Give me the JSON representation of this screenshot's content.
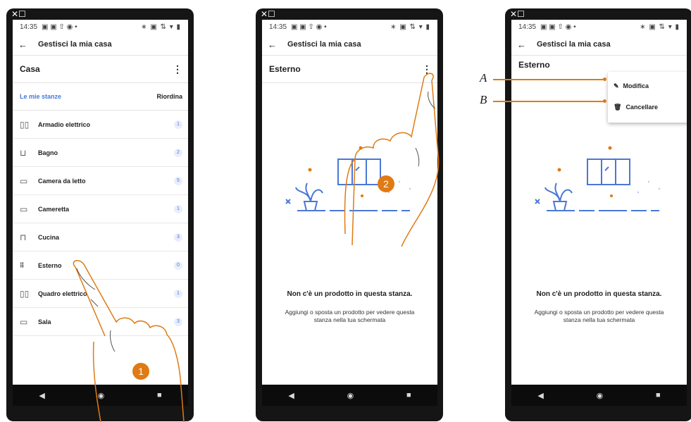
{
  "status": {
    "time": "14:35",
    "left_icons": "▣ ▣ ⇧ ◉ •",
    "right_icons": "∗ ▣ ⇅ ▾ ▮"
  },
  "window_icons": "✕☐",
  "appbar": {
    "back_icon": "←",
    "title": "Gestisci la mia casa"
  },
  "screen1": {
    "header": "Casa",
    "section_title": "Le mie stanze",
    "reorder": "Riordina",
    "rooms": [
      {
        "label": "Armadio elettrico",
        "count": "1",
        "icon": "▯▯"
      },
      {
        "label": "Bagno",
        "count": "2",
        "icon": "⊔"
      },
      {
        "label": "Camera da letto",
        "count": "5",
        "icon": "▭"
      },
      {
        "label": "Cameretta",
        "count": "1",
        "icon": "▭"
      },
      {
        "label": "Cucina",
        "count": "3",
        "icon": "⊓"
      },
      {
        "label": "Esterno",
        "count": "0",
        "icon": "⩩"
      },
      {
        "label": "Quadro elettrico",
        "count": "1",
        "icon": "▯▯"
      },
      {
        "label": "Sala",
        "count": "3",
        "icon": "▭"
      }
    ],
    "step": "1"
  },
  "screen2": {
    "header": "Esterno",
    "empty_title": "Non c'è un prodotto in questa stanza.",
    "empty_desc": "Aggiungi o sposta un prodotto per vedere questa stanza nella tua schermata",
    "step": "2"
  },
  "screen3": {
    "header": "Esterno",
    "menu": {
      "edit": "Modifica",
      "delete": "Cancellare"
    },
    "empty_title": "Non c'è un prodotto in questa stanza.",
    "empty_desc": "Aggiungi o sposta un prodotto per vedere questa stanza nella tua schermata"
  },
  "callouts": {
    "a": "A",
    "b": "B"
  },
  "navbar": {
    "back": "◀",
    "home": "◉",
    "recents": "■"
  },
  "colors": {
    "accent": "#e07a14",
    "blue": "#4a78d6"
  }
}
